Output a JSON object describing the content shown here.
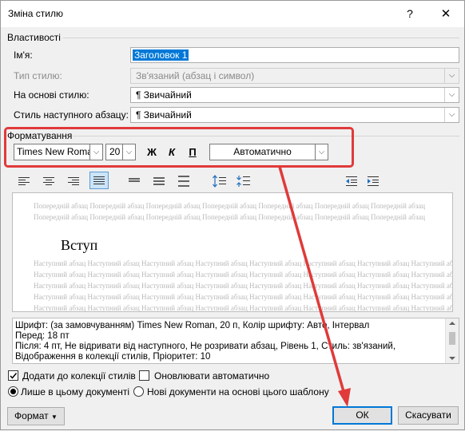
{
  "window": {
    "title": "Зміна стилю",
    "help": "?",
    "close": "✕"
  },
  "properties": {
    "group_label": "Властивості",
    "name_label": "Ім'я:",
    "name_value": "Заголовок 1",
    "type_label": "Тип стилю:",
    "type_value": "Зв'язаний (абзац і символ)",
    "based_label": "На основі стилю:",
    "based_value": "¶  Звичайний",
    "next_label": "Стиль наступного абзацу:",
    "next_value": "¶  Звичайний"
  },
  "formatting": {
    "group_label": "Форматування",
    "font": "Times New Roman",
    "size": "20",
    "bold": "Ж",
    "italic": "К",
    "underline": "П",
    "color": "Автоматично"
  },
  "preview": {
    "prev_lines": [
      "Попередній абзац Попередній абзац Попередній абзац Попередній абзац Попередній абзац Попередній абзац Попередній абзац",
      "Попередній абзац Попередній абзац Попередній абзац Попередній абзац Попередній абзац Попередній абзац Попередній абзац"
    ],
    "heading": "Вступ",
    "next_lines": [
      "Наступний абзац Наступний абзац Наступний абзац Наступний абзац Наступний абзац Наступний абзац Наступний абзац Наступний абзац",
      "Наступний абзац Наступний абзац Наступний абзац Наступний абзац Наступний абзац Наступний абзац Наступний абзац Наступний абзац",
      "Наступний абзац Наступний абзац Наступний абзац Наступний абзац Наступний абзац Наступний абзац Наступний абзац Наступний абзац",
      "Наступний абзац Наступний абзац Наступний абзац Наступний абзац Наступний абзац Наступний абзац Наступний абзац Наступний абзац",
      "Наступний абзац Наступний абзац Наступний абзац Наступний абзац Наступний абзац Наступний абзац Наступний абзац Наступний абзац"
    ]
  },
  "description": [
    "Шрифт: (за замовчуванням) Times New Roman, 20 п, Колір шрифту: Авто, Інтервал",
    "   Перед:  18 пт",
    "   Після:  4 пт, Не відривати від наступного, Не розривати абзац, Рівень 1, Стиль: зв'язаний,",
    "Відображення в колекції стилів, Пріоритет: 10"
  ],
  "options": {
    "add_to_gallery": "Додати до колекції стилів",
    "add_to_gallery_checked": true,
    "auto_update": "Оновлювати автоматично",
    "auto_update_checked": false,
    "only_this_doc": "Лише в цьому документі",
    "new_docs": "Нові документи на основі цього шаблону",
    "selected_scope": "only_this_doc"
  },
  "buttons": {
    "format": "Формат",
    "ok": "ОК",
    "cancel": "Скасувати"
  },
  "colors": {
    "annotation": "#e03a3a",
    "accent": "#0078d7",
    "name_highlight": "#0078d7"
  },
  "icons": {
    "align": [
      "align-left-icon",
      "align-center-icon",
      "align-right-icon",
      "justify-icon"
    ],
    "spacing": [
      "single-spacing-icon",
      "one-half-spacing-icon",
      "double-spacing-icon"
    ],
    "para": [
      "space-before-increase-icon",
      "space-before-decrease-icon",
      "indent-decrease-icon",
      "indent-increase-icon"
    ]
  }
}
